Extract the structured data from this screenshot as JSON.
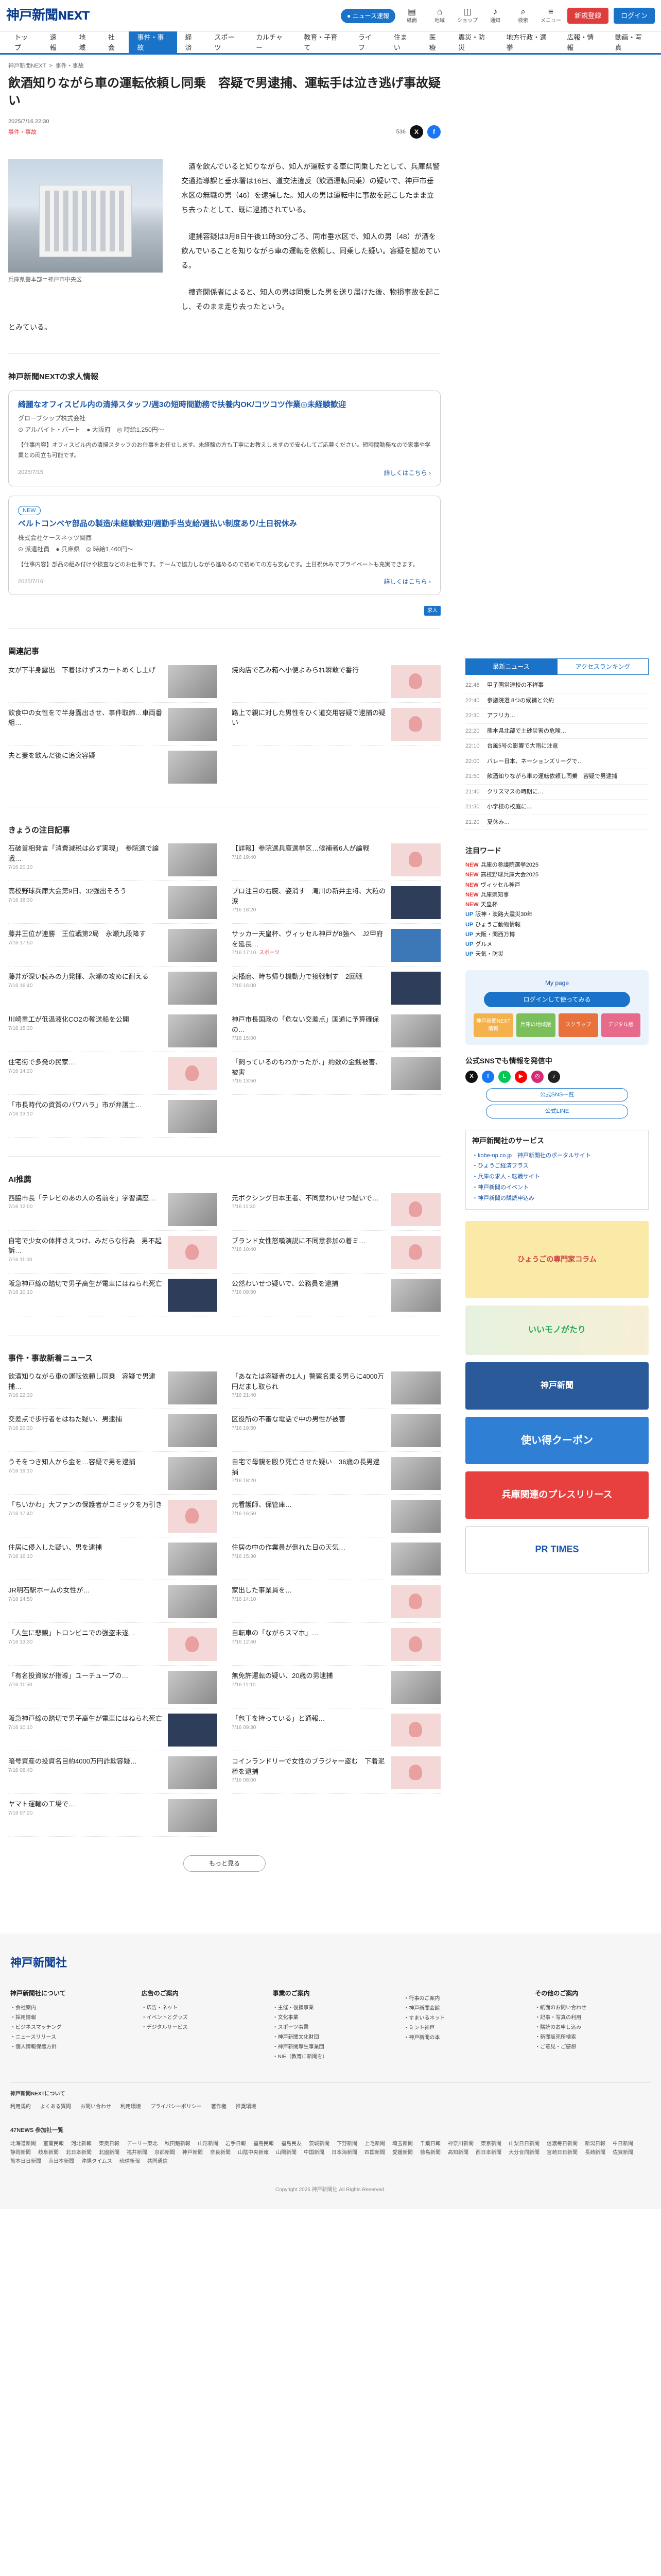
{
  "header": {
    "logo_main": "神戸新聞",
    "logo_next": "NEXT",
    "pill": "● ニュース速報",
    "icons": [
      {
        "name": "news-icon",
        "glyph": "▤",
        "label": "紙面"
      },
      {
        "name": "local-icon",
        "glyph": "⌂",
        "label": "地域"
      },
      {
        "name": "bag-icon",
        "glyph": "◫",
        "label": "ショップ"
      },
      {
        "name": "bell-icon",
        "glyph": "♪",
        "label": "通知"
      },
      {
        "name": "search-icon",
        "glyph": "⌕",
        "label": "検索"
      },
      {
        "name": "menu-icon",
        "glyph": "≡",
        "label": "メニュー"
      }
    ],
    "register": "新規登録",
    "login": "ログイン"
  },
  "nav": [
    "トップ",
    "速報",
    "地域",
    "社会",
    "事件・事故",
    "経済",
    "スポーツ",
    "カルチャー",
    "教育・子育て",
    "ライフ",
    "住まい",
    "医療",
    "震災・防災",
    "地方行政・選挙",
    "広報・情報",
    "動画・写真"
  ],
  "article": {
    "breadcrumb": [
      "神戸新聞NEXT",
      ">",
      "事件・事故"
    ],
    "title": "飲酒知りながら車の運転依頼し同乗　容疑で男逮捕、運転手は泣き逃げ事故疑い",
    "date": "2025/7/16 22:30",
    "category": "事件・事故",
    "share_count": "536",
    "photo_caption": "兵庫県警本部＝神戸市中央区",
    "paragraphs": [
      "酒を飲んでいると知りながら、知人が運転する車に同乗したとして、兵庫県警交通指導課と垂水署は16日、道交法違反（飲酒運転同乗）の疑いで、神戸市垂水区の無職の男（46）を逮捕した。知人の男は運転中に事故を起こしたまま立ち去ったとして、既に逮捕されている。",
      "逮捕容疑は3月8日午後11時30分ごろ、同市垂水区で、知人の男（48）が酒を飲んでいることを知りながら車の運転を依頼し、同乗した疑い。容疑を認めている。",
      "捜査関係者によると、知人の男は同乗した男を送り届けた後、物損事故を起こし、そのまま走り去ったという。"
    ],
    "last_line": "とみている。"
  },
  "jobs": {
    "section": "神戸新聞NEXTの求人情報",
    "items": [
      {
        "new": "",
        "title": "綺麗なオフィスビル内の清掃スタッフ/週3の短時間勤務で扶養内OK/コツコツ作業◎未経験歓迎",
        "company": "グローブシップ株式会社",
        "tags": "⊙ アルバイト・パート　● 大阪府　◎ 時給1,250円〜",
        "desc": "【仕事内容】オフィスビル内の清掃スタッフのお仕事をお任せします。未経験の方も丁寧にお教えしますので安心してご応募ください。短時間勤務なので家事や学業との両立も可能です。",
        "posted": "2025/7/15",
        "more": "詳しくはこちら"
      },
      {
        "new": "NEW",
        "title": "ベルトコンベヤ部品の製造/未経験歓迎/週勤手当支給/週払い制度あり/土日祝休み",
        "company": "株式会社ケースネッツ関西",
        "tags": "⊙ 派遣社員　● 兵庫県　◎ 時給1,460円〜",
        "desc": "【仕事内容】部品の組み付けや検査などのお仕事です。チームで協力しながら進めるので初めての方も安心です。土日祝休みでプライベートも充実できます。",
        "posted": "2025/7/16",
        "more": "詳しくはこちら"
      }
    ],
    "ad_label": "求人"
  },
  "related": {
    "section": "関連記事",
    "items": [
      {
        "t": "女が下半身露出　下着はけずスカートめくし上げ",
        "d": "",
        "th": "grey"
      },
      {
        "t": "焼肉店で乙み箱へ小便よみられ瞬敢で番行",
        "d": "",
        "th": "pink"
      },
      {
        "t": "飲食中の女性をで半身露出させ、事件取締…車両番組…",
        "d": "",
        "th": "grey"
      },
      {
        "t": "路上で親に対した男性をひく道交用容疑で逮捕の疑い",
        "d": "",
        "th": "pink"
      },
      {
        "t": "夫と妻を飲んだ後に追突容疑",
        "d": "",
        "th": "grey"
      }
    ]
  },
  "today": {
    "section": "きょうの注目記事",
    "items": [
      {
        "t": "石破首相発言「消費減税は必ず実現」　参院選で論戦…",
        "d": "7/16 20:10",
        "lb": "",
        "th": "grey"
      },
      {
        "t": "【詳報】参院選兵庫選挙区…候補者6人が論戦",
        "d": "7/16 19:40",
        "lb": "",
        "th": "pink"
      },
      {
        "t": "高校野球兵庫大会第9日、32強出そろう",
        "d": "7/16 18:30",
        "lb": "",
        "th": "grey"
      },
      {
        "t": "プロ注目の右腕、姿消す　滝川の新井主将、大粒の涙",
        "d": "7/16 18:20",
        "lb": "",
        "th": "navy"
      },
      {
        "t": "藤井王位が連勝　王位戦第2局　永瀬九段降す",
        "d": "7/16 17:50",
        "lb": "",
        "th": "grey"
      },
      {
        "t": "サッカー天皇杯、ヴィッセル神戸が8強へ　J2甲府を延長…",
        "d": "7/16 17:10",
        "lb": "スポーツ",
        "th": "blue"
      },
      {
        "t": "藤井が深い読みの力発揮、永瀬の攻めに耐える",
        "d": "7/16 16:40",
        "lb": "",
        "th": "grey"
      },
      {
        "t": "東播磨、時ち帰り機動力で接戦制す　2回戦",
        "d": "7/16 16:00",
        "lb": "",
        "th": "navy"
      },
      {
        "t": "川崎重工が低温液化CO2の輸送船を公開",
        "d": "7/16 15:30",
        "lb": "",
        "th": "grey"
      },
      {
        "t": "神戸市長国政の「危ない交差点」国道に予算確保の…",
        "d": "7/16 15:00",
        "lb": "",
        "th": "grey"
      },
      {
        "t": "住宅街で多発の民家…",
        "d": "7/16 14:20",
        "lb": "",
        "th": "pink"
      },
      {
        "t": "「飼っているのもわかったが、」約数の金銭被害、被害",
        "d": "7/16 13:50",
        "lb": "",
        "th": "grey"
      },
      {
        "t": "「市長時代の資質のパワハラ」市が弁護士…",
        "d": "7/16 13:10",
        "lb": "",
        "th": "grey"
      }
    ]
  },
  "ai": {
    "section": "AI推薦",
    "items": [
      {
        "t": "西脇市長「テレビのあの人の名前を」学習講座…",
        "d": "7/16 12:00",
        "th": "grey"
      },
      {
        "t": "元ボクシング日本王者、不同意わいせつ疑いで…",
        "d": "7/16 11:30",
        "th": "pink"
      },
      {
        "t": "自宅で少女の体押さえつけ、みだらな行為　男不起訴…",
        "d": "7/16 11:00",
        "th": "pink"
      },
      {
        "t": "ブランド女性怒嘆演説に不同意参加の着ミ…",
        "d": "7/16 10:40",
        "th": "pink"
      },
      {
        "t": "阪急神戸線の踏切で男子高生が電車にはねられ死亡",
        "d": "7/16 10:10",
        "th": "navy"
      },
      {
        "t": "公然わいせつ疑いで、公務員を逮捕",
        "d": "7/16 09:50",
        "th": "grey"
      }
    ]
  },
  "crime": {
    "section": "事件・事故新着ニュース",
    "items": [
      {
        "t": "飲酒知りながら車の運転依頼し同乗　容疑で男逮捕…",
        "d": "7/16 22:30",
        "th": "grey"
      },
      {
        "t": "「あなたは容疑者の1人」警察名乗る男らに4000万円だまし取られ",
        "d": "7/16 21:40",
        "th": "grey"
      },
      {
        "t": "交差点で歩行者をはねた疑い、男逮捕",
        "d": "7/16 20:30",
        "th": "grey"
      },
      {
        "t": "区役所の不審な電話で中の男性が被害",
        "d": "7/16 19:50",
        "th": "grey"
      },
      {
        "t": "うそをつき知人から金を…容疑で男を逮捕",
        "d": "7/16 19:10",
        "th": "grey"
      },
      {
        "t": "自宅で母親を殴り死亡させた疑い　36歳の長男逮捕",
        "d": "7/16 18:20",
        "th": "grey"
      },
      {
        "t": "「ちいかわ」大ファンの保護者がコミックを万引き",
        "d": "7/16 17:40",
        "th": "pink"
      },
      {
        "t": "元看護師、保管庫…",
        "d": "7/16 16:50",
        "th": "grey"
      },
      {
        "t": "住居に侵入した疑い、男を逮捕",
        "d": "7/16 16:10",
        "th": "grey"
      },
      {
        "t": "住居の中の作業員が倒れた日の天気…",
        "d": "7/16 15:30",
        "th": "grey"
      },
      {
        "t": "JR明石駅ホームの女性が…",
        "d": "7/16 14:50",
        "th": "grey"
      },
      {
        "t": "家出した事業員を…",
        "d": "7/16 14:10",
        "th": "pink"
      },
      {
        "t": "「人生に悲観」トロンビニでの強盗未遂…",
        "d": "7/16 13:30",
        "th": "pink"
      },
      {
        "t": "自転車の「ながらスマホ」…",
        "d": "7/16 12:40",
        "th": "pink"
      },
      {
        "t": "「有名投資家が指導」ユーチューブの…",
        "d": "7/16 11:50",
        "th": "grey"
      },
      {
        "t": "無免許運転の疑い、20歳の男逮捕",
        "d": "7/16 11:10",
        "th": "grey"
      },
      {
        "t": "阪急神戸線の踏切で男子高生が電車にはねられ死亡",
        "d": "7/16 10:10",
        "th": "navy"
      },
      {
        "t": "「包丁を持っている」と通報…",
        "d": "7/16 09:30",
        "th": "pink"
      },
      {
        "t": "暗号資産の投資名目約4000万円詐欺容疑…",
        "d": "7/16 08:40",
        "th": "grey"
      },
      {
        "t": "コインランドリーで女性のブラジャー盗む　下着泥棒を逮捕",
        "d": "7/16 08:00",
        "th": "pink"
      },
      {
        "t": "ヤマト運輸の工場で…",
        "d": "7/16 07:20",
        "th": "grey"
      }
    ],
    "more": "もっと見る"
  },
  "sidebar": {
    "tabs": [
      "最新ニュース",
      "アクセスランキング"
    ],
    "ranking": [
      {
        "tm": "22:48",
        "t": "甲子園常連校の不祥事"
      },
      {
        "tm": "22:40",
        "t": "参議院選 8つの候補と公約"
      },
      {
        "tm": "22:30",
        "t": "アフリカ…"
      },
      {
        "tm": "22:20",
        "t": "熊本県北部で土砂災害の危険…"
      },
      {
        "tm": "22:10",
        "t": "台風5号の影響で大雨に注意"
      },
      {
        "tm": "22:00",
        "t": "バレー日本、ネーションズリーグで…"
      },
      {
        "tm": "21:50",
        "t": "飲酒知りながら車の運転依頼し同乗　容疑で男逮捕"
      },
      {
        "tm": "21:40",
        "t": "クリスマスの時期に…"
      },
      {
        "tm": "21:30",
        "t": "小学校の校庭に…"
      },
      {
        "tm": "21:20",
        "t": "夏休み…"
      }
    ],
    "keyword_title": "注目ワード",
    "keywords": [
      {
        "tag": "NEW",
        "t": "兵庫の参議院選挙2025"
      },
      {
        "tag": "NEW",
        "t": "高校野球兵庫大会2025"
      },
      {
        "tag": "NEW",
        "t": "ヴィッセル神戸"
      },
      {
        "tag": "NEW",
        "t": "兵庫県知事"
      },
      {
        "tag": "NEW",
        "t": "天皇杯"
      },
      {
        "tag": "UP",
        "t": "阪神・淡路大震災30年"
      },
      {
        "tag": "UP",
        "t": "ひょうご動物情報"
      },
      {
        "tag": "UP",
        "t": "大阪・関西万博"
      },
      {
        "tag": "UP",
        "t": "グルメ"
      },
      {
        "tag": "UP",
        "t": "天気・防災"
      }
    ],
    "mypage_title": "My page",
    "mypage_login": "ログインして使ってみる",
    "mypage_tiles": [
      "神戸新聞NEXT情報",
      "兵庫の地域版",
      "スクラップ",
      "デジタル版"
    ],
    "sns_title": "公式SNSでも情報を発信中",
    "sns": [
      {
        "name": "x-icon",
        "g": "X",
        "color": "#111111"
      },
      {
        "name": "facebook-icon",
        "g": "f",
        "color": "#1877f2"
      },
      {
        "name": "line-icon",
        "g": "L",
        "color": "#06c755"
      },
      {
        "name": "youtube-icon",
        "g": "▶",
        "color": "#ff0000"
      },
      {
        "name": "instagram-icon",
        "g": "◎",
        "color": "#d62976"
      },
      {
        "name": "tiktok-icon",
        "g": "♪",
        "color": "#222222"
      }
    ],
    "sns_links": [
      "公式SNS一覧",
      "公式LINE"
    ],
    "service_title": "神戸新聞社のサービス",
    "services": [
      "・kobe-np.co.jp　神戸新聞社のポータルサイト",
      "・ひょうご経済プラス",
      "・兵庫の求人・転職サイト",
      "・神戸新聞のイベント",
      "・神戸新聞の購読申込み"
    ],
    "banners": [
      {
        "cls": "y",
        "t": "ひょうごの専門家コラム"
      },
      {
        "cls": "k",
        "t": "いいモノがたり"
      },
      {
        "cls": "b",
        "t": "神戸新聞"
      },
      {
        "cls": "c",
        "t": "使い得クーポン"
      },
      {
        "cls": "r",
        "t": "兵庫関連のプレスリリース"
      },
      {
        "cls": "w",
        "t": "PR TIMES"
      }
    ]
  },
  "footer": {
    "logo": "神戸新聞社",
    "cols": [
      {
        "h": "神戸新聞社について",
        "items": [
          "・会社案内",
          "・採用情報",
          "・ビジネスマッチング",
          "・ニュースリリース",
          "・個人情報保護方針"
        ]
      },
      {
        "h": "広告のご案内",
        "items": [
          "・広告・ネット",
          "・イベントとグッズ",
          "・デジタルサービス"
        ]
      },
      {
        "h": "事業のご案内",
        "items": [
          "・主催・後援事業",
          "・文化事業",
          "・スポーツ事業",
          "・神戸新聞文化財団",
          "・神戸新聞厚生事業団",
          "・NIE（教育に新聞を）"
        ]
      },
      {
        "h": "",
        "items": [
          "・行事のご案内",
          "・神戸新聞会館",
          "・すまいるネット",
          "・ミント神戸",
          "・神戸新聞の本"
        ]
      },
      {
        "h": "その他のご案内",
        "items": [
          "・紙面のお問い合わせ",
          "・記事・写真の利用",
          "・購読のお申し込み",
          "・新聞販売所検索",
          "・ご意見・ご感想"
        ]
      }
    ],
    "about": "神戸新聞NEXTについて",
    "links": [
      "利用規約",
      "よくある質問",
      "お問い合わせ",
      "利用環境",
      "プライバシーポリシー",
      "著作権",
      "推奨環境"
    ],
    "pref_title": "47NEWS 参加社一覧",
    "prefs": [
      "北海道新聞",
      "室蘭民報",
      "河北新報",
      "東奥日報",
      "デーリー東北",
      "秋田魁新報",
      "山形新聞",
      "岩手日報",
      "福島民報",
      "福島民友",
      "茨城新聞",
      "下野新聞",
      "上毛新聞",
      "埼玉新聞",
      "千葉日報",
      "神奈川新聞",
      "東京新聞",
      "山梨日日新聞",
      "信濃毎日新聞",
      "新潟日報",
      "中日新聞",
      "静岡新聞",
      "岐阜新聞",
      "北日本新聞",
      "北國新聞",
      "福井新聞",
      "京都新聞",
      "神戸新聞",
      "奈良新聞",
      "山陰中央新報",
      "山陽新聞",
      "中国新聞",
      "日本海新聞",
      "四国新聞",
      "愛媛新聞",
      "徳島新聞",
      "高知新聞",
      "西日本新聞",
      "大分合同新聞",
      "宮崎日日新聞",
      "長崎新聞",
      "佐賀新聞",
      "熊本日日新聞",
      "南日本新聞",
      "沖縄タイムス",
      "琉球新報",
      "共同通信"
    ],
    "copyright": "Copyright 2025 神戸新聞社 All Rights Reserved."
  }
}
